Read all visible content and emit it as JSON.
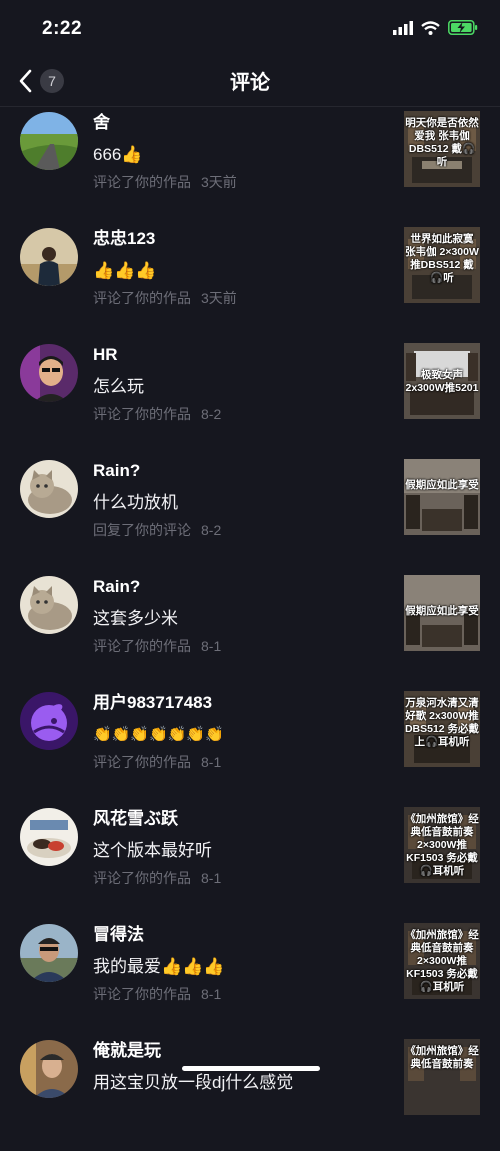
{
  "status": {
    "time": "2:22"
  },
  "nav": {
    "back_count": "7",
    "title": "评论"
  },
  "comments": [
    {
      "name": "舍",
      "message": "666👍",
      "action": "评论了你的作品",
      "time": "3天前",
      "thumb_caption": "明天你是否依然爱我 张韦伽 DBS512 戴🎧听",
      "avatar_icon": "landscape-avatar"
    },
    {
      "name": "忠忠123",
      "message": "👍👍👍",
      "action": "评论了你的作品",
      "time": "3天前",
      "thumb_caption": "世界如此寂寞 张韦伽 2×300W推DBS512 戴🎧听",
      "avatar_icon": "person-avatar"
    },
    {
      "name": "HR",
      "message": "怎么玩",
      "action": "评论了你的作品",
      "time": "8-2",
      "thumb_caption": "极致女声 2x300W推5201",
      "avatar_icon": "person-avatar"
    },
    {
      "name": "Rain?",
      "message": "什么功放机",
      "action": "回复了你的评论",
      "time": "8-2",
      "thumb_caption": "假期应如此享受",
      "avatar_icon": "cat-avatar"
    },
    {
      "name": "Rain?",
      "message": "这套多少米",
      "action": "评论了你的作品",
      "time": "8-1",
      "thumb_caption": "假期应如此享受",
      "avatar_icon": "cat-avatar"
    },
    {
      "name": "用户983717483",
      "message": "👏👏👏👏👏👏👏",
      "action": "评论了你的作品",
      "time": "8-1",
      "thumb_caption": "万泉河水清又清 好歌 2x300W推DBS512 务必戴上🎧耳机听",
      "avatar_icon": "default-user-avatar"
    },
    {
      "name": "风花雪ぶ跃",
      "message": "这个版本最好听",
      "action": "评论了你的作品",
      "time": "8-1",
      "thumb_caption": "《加州旅馆》经典低音鼓前奏 2×300W推KF1503 务必戴🎧耳机听",
      "avatar_icon": "food-avatar"
    },
    {
      "name": "冒得法",
      "message": "我的最爱👍👍👍",
      "action": "评论了你的作品",
      "time": "8-1",
      "thumb_caption": "《加州旅馆》经典低音鼓前奏 2×300W推KF1503 务必戴🎧耳机听",
      "avatar_icon": "person-avatar"
    },
    {
      "name": "俺就是玩",
      "message": "用这宝贝放一段dj什么感觉",
      "action": "",
      "time": "",
      "thumb_caption": "《加州旅馆》经典低音鼓前奏",
      "avatar_icon": "person-avatar"
    }
  ]
}
